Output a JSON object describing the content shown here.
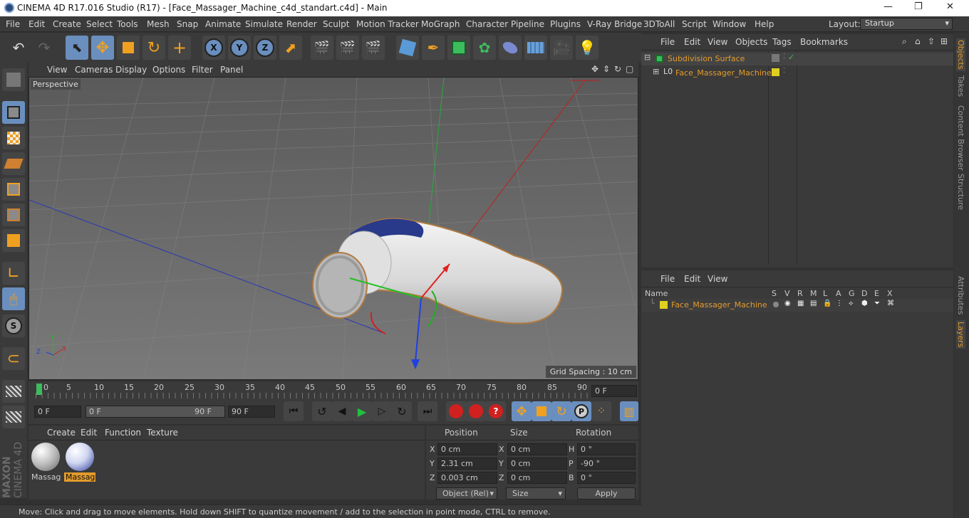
{
  "window": {
    "title": "CINEMA 4D R17.016 Studio (R17) - [Face_Massager_Machine_c4d_standart.c4d] - Main",
    "min": "—",
    "max": "❐",
    "close": "✕"
  },
  "menu": [
    "File",
    "Edit",
    "Create",
    "Select",
    "Tools",
    "Mesh",
    "Snap",
    "Animate",
    "Simulate",
    "Render",
    "Sculpt",
    "Motion Tracker",
    "MoGraph",
    "Character",
    "Pipeline",
    "Plugins",
    "V-Ray Bridge",
    "3DToAll",
    "Script",
    "Window",
    "Help"
  ],
  "layout": {
    "label": "Layout:",
    "value": "Startup"
  },
  "viewport": {
    "menu": [
      "View",
      "Cameras",
      "Display",
      "Options",
      "Filter",
      "Panel"
    ],
    "camera": "Perspective",
    "grid_spacing": "Grid Spacing : 10 cm"
  },
  "timeline": {
    "ticks": [
      "0",
      "5",
      "10",
      "15",
      "20",
      "25",
      "30",
      "35",
      "40",
      "45",
      "50",
      "55",
      "60",
      "65",
      "70",
      "75",
      "80",
      "85",
      "90"
    ],
    "end_field": "0 F"
  },
  "transport": {
    "current": "0 F",
    "range_start": "0 F",
    "range_end": "90 F",
    "max": "90 F"
  },
  "materials": {
    "menu": [
      "Create",
      "Edit",
      "Function",
      "Texture"
    ],
    "items": [
      "Massag",
      "Massag"
    ]
  },
  "coords": {
    "headers": [
      "Position",
      "Size",
      "Rotation"
    ],
    "rows": [
      {
        "axis": "X",
        "pos": "0 cm",
        "saxis": "X",
        "size": "0 cm",
        "raxis": "H",
        "rot": "0 °"
      },
      {
        "axis": "Y",
        "pos": "2.31 cm",
        "saxis": "Y",
        "size": "0 cm",
        "raxis": "P",
        "rot": "-90 °"
      },
      {
        "axis": "Z",
        "pos": "0.003 cm",
        "saxis": "Z",
        "size": "0 cm",
        "raxis": "B",
        "rot": "0 °"
      }
    ],
    "mode": "Object (Rel)",
    "size_mode": "Size",
    "apply": "Apply"
  },
  "objects": {
    "menu": [
      "File",
      "Edit",
      "View",
      "Objects",
      "Tags",
      "Bookmarks"
    ],
    "items": [
      "Subdivision Surface",
      "Face_Massager_Machine"
    ]
  },
  "layers": {
    "menu": [
      "File",
      "Edit",
      "View"
    ],
    "header_name": "Name",
    "cols": [
      "S",
      "V",
      "R",
      "M",
      "L",
      "A",
      "G",
      "D",
      "E",
      "X"
    ],
    "row": "Face_Massager_Machine"
  },
  "right_tabs": [
    "Objects",
    "Takes",
    "Content Browser",
    "Structure",
    "Attributes",
    "Layers"
  ],
  "status": "Move: Click and drag to move elements. Hold down SHIFT to quantize movement / add to the selection in point mode, CTRL to remove.",
  "brand": [
    "MAXON",
    "CINEMA 4D"
  ],
  "colors": {
    "accent": "#6a8fbf",
    "orange": "#e39b2c",
    "yellow": "#e0d020"
  }
}
